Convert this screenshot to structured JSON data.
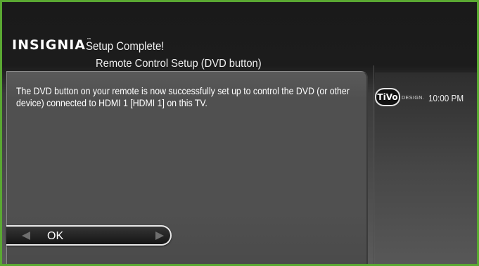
{
  "brand": {
    "name": "INSIGNIA",
    "mark": "™"
  },
  "screen": {
    "title": "Setup Complete!",
    "subtitle": "Remote Control Setup (DVD button)"
  },
  "message": "The DVD button on your remote is now successfully set up to control the DVD (or other device) connected to HDMI 1 [HDMI 1] on this TV.",
  "status": {
    "tivo_logo": "TiVo",
    "tivo_design": "DESIGN.",
    "time": "10:00 PM"
  },
  "actions": {
    "ok_label": "OK"
  },
  "icons": {
    "left_arrow": "triangle-left-icon",
    "right_arrow": "triangle-right-icon"
  },
  "colors": {
    "border": "#5aa832",
    "background_top": "#1a1a1a",
    "panel": "#505050",
    "text": "#ffffff"
  }
}
